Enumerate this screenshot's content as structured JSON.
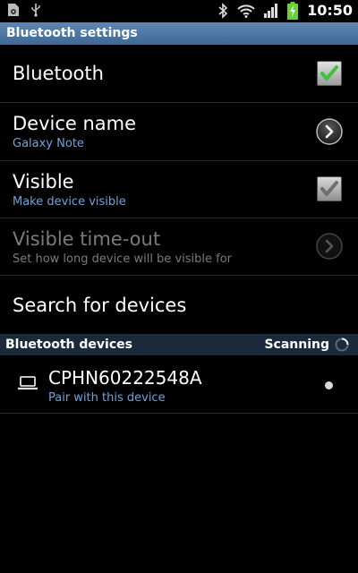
{
  "status_bar": {
    "time": "10:50",
    "icons": [
      "storage-icon",
      "usb-icon",
      "bluetooth-icon",
      "wifi-icon",
      "signal-icon",
      "battery-charging-icon"
    ]
  },
  "header": {
    "title": "Bluetooth settings"
  },
  "settings": [
    {
      "title": "Bluetooth",
      "subtitle": "",
      "control": "checkbox",
      "checked": true,
      "enabled": true,
      "check_color": "#3cc23c"
    },
    {
      "title": "Device name",
      "subtitle": "Galaxy Note",
      "control": "chevron",
      "enabled": true
    },
    {
      "title": "Visible",
      "subtitle": "Make device visible",
      "control": "checkbox",
      "checked": true,
      "enabled": true,
      "check_color": "#7a7a7a"
    },
    {
      "title": "Visible time-out",
      "subtitle": "Set how long device will be visible for",
      "control": "chevron",
      "enabled": false
    },
    {
      "title": "Search for devices",
      "subtitle": "",
      "control": "none",
      "enabled": true
    }
  ],
  "devices_section": {
    "title": "Bluetooth devices",
    "status": "Scanning"
  },
  "devices": [
    {
      "name": "CPHN60222548A",
      "subtitle": "Pair with this device",
      "icon": "laptop-icon"
    }
  ],
  "colors": {
    "header_bar": "#4a76a6",
    "section_bar": "#1b2a3b",
    "subtitle": "#6fa3d9",
    "disabled": "#7a7a7a"
  }
}
